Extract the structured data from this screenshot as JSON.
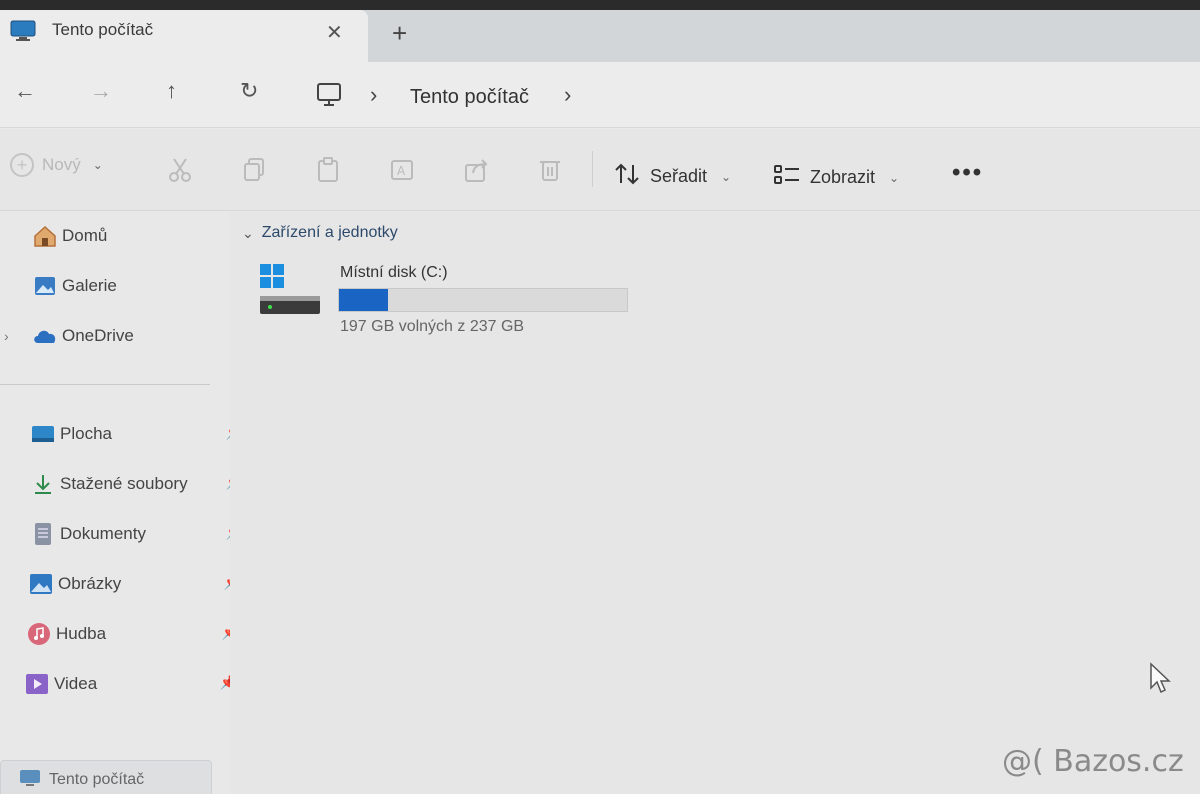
{
  "tab": {
    "title": "Tento počítač",
    "close": "✕",
    "new": "+"
  },
  "nav": {
    "back": "←",
    "forward": "→",
    "up": "↑",
    "refresh": "↻",
    "chevron": "›",
    "location": "Tento počítač"
  },
  "toolbar": {
    "new_label": "Nový",
    "sort_label": "Seřadit",
    "view_label": "Zobrazit",
    "more": "•••"
  },
  "sidebar": {
    "items": [
      {
        "label": "Domů",
        "icon": "home-icon"
      },
      {
        "label": "Galerie",
        "icon": "gallery-icon"
      },
      {
        "label": "OneDrive",
        "icon": "cloud-icon"
      }
    ],
    "pinned": [
      {
        "label": "Plocha",
        "icon": "desktop-folder-icon"
      },
      {
        "label": "Stažené soubory",
        "icon": "download-icon"
      },
      {
        "label": "Dokumenty",
        "icon": "documents-icon"
      },
      {
        "label": "Obrázky",
        "icon": "pictures-icon"
      },
      {
        "label": "Hudba",
        "icon": "music-icon"
      },
      {
        "label": "Videa",
        "icon": "videos-icon"
      }
    ],
    "selected": "Tento počítač"
  },
  "main": {
    "group_title": "Zařízení a jednotky",
    "drive": {
      "name": "Místní disk (C:)",
      "free_text": "197 GB volných z 237 GB",
      "used_fraction": 0.17,
      "bar_color": "#1a64c4"
    }
  },
  "watermark": "@( Bazos.cz",
  "colors": {
    "accent": "#1a64c4",
    "link": "#2d4a6b"
  }
}
